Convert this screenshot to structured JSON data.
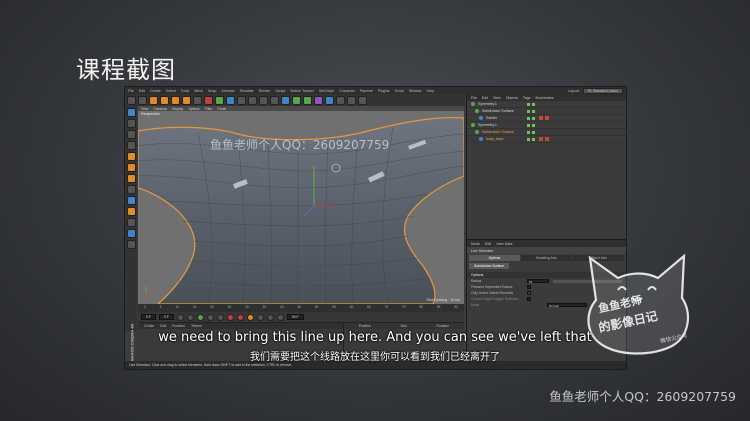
{
  "slide": {
    "title": "课程截图",
    "subtitle_en": "we need to bring this line up here. And you can see we've left that",
    "subtitle_zh": "我们需要把这个线路放在这里你可以看到我们已经离开了",
    "watermark": "鱼鱼老师个人QQ：2609207759",
    "stamp_line1": "鱼鱼老师",
    "stamp_line2": "的影像日记",
    "stamp_line3": "微信公众号"
  },
  "app": {
    "menu": [
      "File",
      "Edit",
      "Create",
      "Select",
      "Tools",
      "Mesh",
      "Snap",
      "Animate",
      "Simulate",
      "Render",
      "Sculpt",
      "Motion Tracker",
      "MoGraph",
      "Character",
      "Pipeline",
      "Plugins",
      "Script",
      "Window",
      "Help"
    ],
    "layout_label": "Layout:",
    "layout_value": "PL Standard (user)",
    "viewport": {
      "menu": [
        "View",
        "Cameras",
        "Display",
        "Options",
        "Filter",
        "Panel"
      ],
      "label": "Perspective",
      "grid_spacing": "Grid Spacing : 10 cm",
      "watermark": "鱼鱼老师个人QQ：2609207759"
    },
    "timeline_ticks": [
      "0",
      "5",
      "10",
      "15",
      "20",
      "25",
      "30",
      "35",
      "40",
      "45",
      "50",
      "55",
      "60",
      "65",
      "70",
      "75",
      "80",
      "85",
      "90"
    ],
    "transport": {
      "current_frame": "0 F",
      "start_frame": "0 F",
      "end_frame": "90 F"
    },
    "materials_menu": [
      "Create",
      "Edit",
      "Function",
      "Texture"
    ],
    "coords_head": [
      "Position",
      "Size",
      "Rotation"
    ],
    "brand_vertical": "MAXON CINEMA 4D",
    "status": "Live Selection: Click and drag to select elements. Hold down SHIFT to add to the selection, CTRL to remove.",
    "object_manager": {
      "menu": [
        "File",
        "Edit",
        "View",
        "Objects",
        "Tags",
        "Bookmarks"
      ],
      "objects": [
        {
          "name": "Symmetry.1",
          "selected": false
        },
        {
          "name": "Subdivision Surface",
          "selected": false
        },
        {
          "name": "Subdiv",
          "selected": false
        },
        {
          "name": "Symmetry.1",
          "selected": false
        },
        {
          "name": "Subdivision Surface",
          "selected": true
        },
        {
          "name": "body_base",
          "selected": true
        }
      ]
    },
    "attributes": {
      "menu": [
        "Mode",
        "Edit",
        "User Data"
      ],
      "title": "Live Selection",
      "tabs": [
        "Options",
        "Modeling Axis",
        "Object Axis"
      ],
      "section_tab": "Subdivision Surface",
      "section": "Options",
      "rows": [
        {
          "label": "Radius",
          "value": "10"
        },
        {
          "label": "Pressure Dependent Radius",
          "value": ""
        },
        {
          "label": "Only Select Visible Elements",
          "value": ""
        },
        {
          "label": "Convert Edge/Polygon Selection",
          "value": ""
        },
        {
          "label": "Mode",
          "value": "Normal"
        }
      ]
    }
  }
}
